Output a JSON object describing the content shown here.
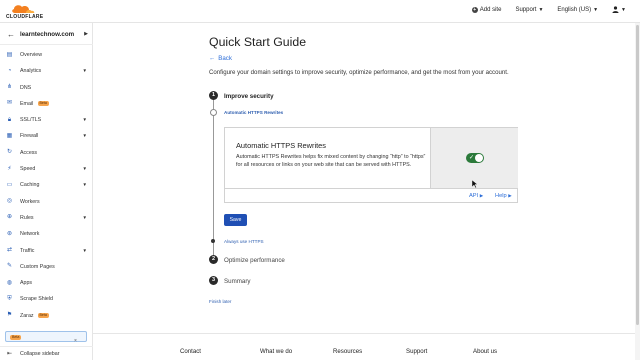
{
  "topbar": {
    "logo_text": "CLOUDFLARE",
    "add_site": "Add site",
    "support": "Support",
    "language": "English (US)"
  },
  "sidebar": {
    "site_name": "learntechnow.com",
    "items": [
      {
        "label": "Overview",
        "icon": "overview-icon",
        "caret": false,
        "beta": false
      },
      {
        "label": "Analytics",
        "icon": "analytics-icon",
        "caret": true,
        "beta": false
      },
      {
        "label": "DNS",
        "icon": "dns-icon",
        "caret": false,
        "beta": false
      },
      {
        "label": "Email",
        "icon": "email-icon",
        "caret": false,
        "beta": true
      },
      {
        "label": "SSL/TLS",
        "icon": "lock-icon",
        "caret": true,
        "beta": false
      },
      {
        "label": "Firewall",
        "icon": "firewall-icon",
        "caret": true,
        "beta": false
      },
      {
        "label": "Access",
        "icon": "access-icon",
        "caret": false,
        "beta": false
      },
      {
        "label": "Speed",
        "icon": "speed-icon",
        "caret": true,
        "beta": false
      },
      {
        "label": "Caching",
        "icon": "caching-icon",
        "caret": true,
        "beta": false
      },
      {
        "label": "Workers",
        "icon": "workers-icon",
        "caret": false,
        "beta": false
      },
      {
        "label": "Rules",
        "icon": "rules-icon",
        "caret": true,
        "beta": false
      },
      {
        "label": "Network",
        "icon": "network-icon",
        "caret": false,
        "beta": false
      },
      {
        "label": "Traffic",
        "icon": "traffic-icon",
        "caret": true,
        "beta": false
      },
      {
        "label": "Custom Pages",
        "icon": "custom-pages-icon",
        "caret": false,
        "beta": false
      },
      {
        "label": "Apps",
        "icon": "apps-icon",
        "caret": false,
        "beta": false
      },
      {
        "label": "Scrape Shield",
        "icon": "shield-icon",
        "caret": false,
        "beta": false
      },
      {
        "label": "Zaraz",
        "icon": "zaraz-icon",
        "caret": false,
        "beta": true
      }
    ],
    "beta_label": "Beta",
    "collapse_label": "Collapse sidebar"
  },
  "main": {
    "title": "Quick Start Guide",
    "back": "Back",
    "description": "Configure your domain settings to improve security, optimize performance, and get the most from your account.",
    "steps": [
      {
        "number": "1",
        "title": "Improve security"
      },
      {
        "number": "2",
        "title": "Optimize performance"
      },
      {
        "number": "3",
        "title": "Summary"
      }
    ],
    "substep_active": "Automatic HTTPS Rewrites",
    "substep_next": "Always use HTTPS",
    "card": {
      "title": "Automatic HTTPS Rewrites",
      "description": "Automatic HTTPS Rewrites helps fix mixed content by changing “http” to “https” for all resources or links on your web site that can be served with HTTPS.",
      "toggle_on": true,
      "api_link": "API",
      "help_link": "Help"
    },
    "save_label": "Save",
    "finish_later": "Finish later"
  },
  "footer": {
    "columns": [
      "Contact",
      "What we do",
      "Resources",
      "Support",
      "About us"
    ]
  },
  "colors": {
    "accent_blue": "#1f4fb4",
    "link_blue": "#2d6ed8",
    "toggle_green": "#2c7a3b",
    "beta_orange": "#f6a44c",
    "logo_orange": "#f38020"
  }
}
